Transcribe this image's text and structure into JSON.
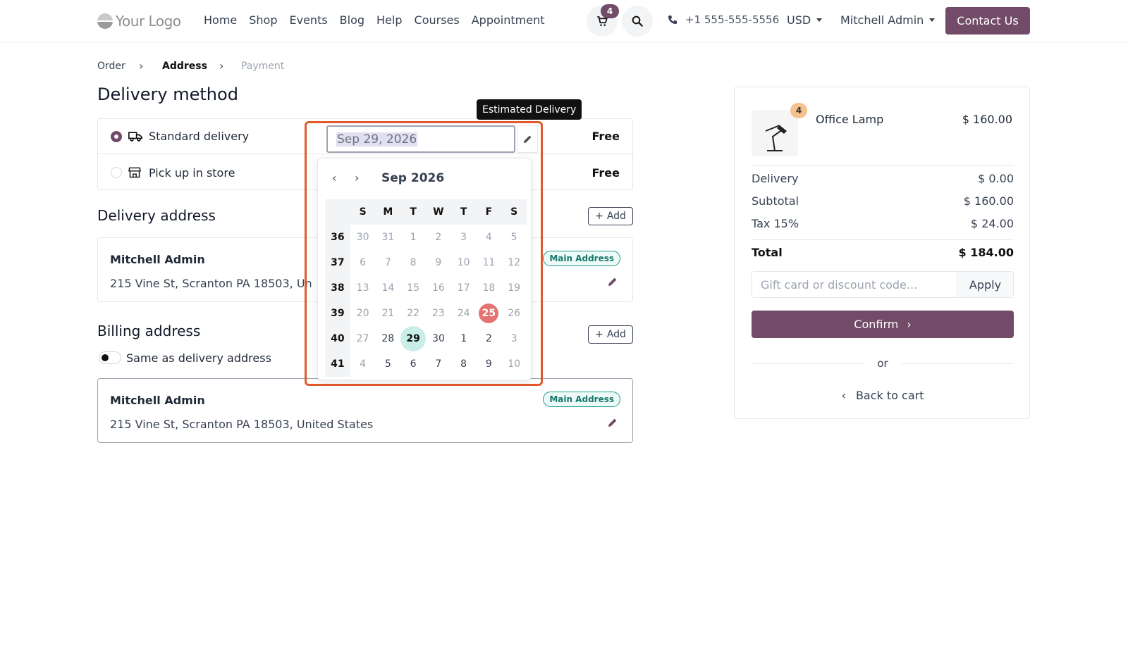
{
  "header": {
    "logo_text": "Your Logo",
    "nav": [
      "Home",
      "Shop",
      "Events",
      "Blog",
      "Help",
      "Courses",
      "Appointment"
    ],
    "cart_count": "4",
    "phone": "+1 555-555-5556",
    "currency": "USD",
    "user": "Mitchell Admin",
    "contact_label": "Contact Us",
    "brand_color": "#714b67"
  },
  "breadcrumb": {
    "order": "Order",
    "address": "Address",
    "payment": "Payment"
  },
  "delivery_method": {
    "title": "Delivery method",
    "options": [
      {
        "label": "Standard delivery",
        "price": "Free",
        "selected": true
      },
      {
        "label": "Pick up in store",
        "price": "Free",
        "selected": false
      }
    ]
  },
  "datepicker": {
    "tooltip": "Estimated Delivery",
    "value": "Sep 29, 2026",
    "month_title": "Sep 2026",
    "weekdays": [
      "S",
      "M",
      "T",
      "W",
      "T",
      "F",
      "S"
    ],
    "weeks": [
      {
        "num": "36",
        "days": [
          "30",
          "31",
          "1",
          "2",
          "3",
          "4",
          "5"
        ]
      },
      {
        "num": "37",
        "days": [
          "6",
          "7",
          "8",
          "9",
          "10",
          "11",
          "12"
        ]
      },
      {
        "num": "38",
        "days": [
          "13",
          "14",
          "15",
          "16",
          "17",
          "18",
          "19"
        ]
      },
      {
        "num": "39",
        "days": [
          "20",
          "21",
          "22",
          "23",
          "24",
          "25",
          "26"
        ]
      },
      {
        "num": "40",
        "days": [
          "27",
          "28",
          "29",
          "30",
          "1",
          "2",
          "3"
        ]
      },
      {
        "num": "41",
        "days": [
          "4",
          "5",
          "6",
          "7",
          "8",
          "9",
          "10"
        ]
      }
    ],
    "today": "25",
    "selected": "29"
  },
  "delivery_address": {
    "title": "Delivery address",
    "add_label": "Add",
    "name": "Mitchell Admin",
    "line": "215 Vine St, Scranton PA 18503, Un",
    "badge": "Main Address"
  },
  "billing_address": {
    "title": "Billing address",
    "add_label": "Add",
    "same_label": "Same as delivery address",
    "name": "Mitchell Admin",
    "line": "215 Vine St, Scranton PA 18503, United States",
    "badge": "Main Address"
  },
  "summary": {
    "product_name": "Office Lamp",
    "product_price": "$ 160.00",
    "product_qty": "4",
    "rows": [
      {
        "label": "Delivery",
        "value": "$ 0.00"
      },
      {
        "label": "Subtotal",
        "value": "$ 160.00"
      },
      {
        "label": "Tax 15%",
        "value": "$ 24.00"
      }
    ],
    "total_label": "Total",
    "total_value": "$ 184.00",
    "promo_placeholder": "Gift card or discount code...",
    "apply_label": "Apply",
    "confirm_label": "Confirm",
    "or_label": "or",
    "back_label": "Back to cart"
  }
}
